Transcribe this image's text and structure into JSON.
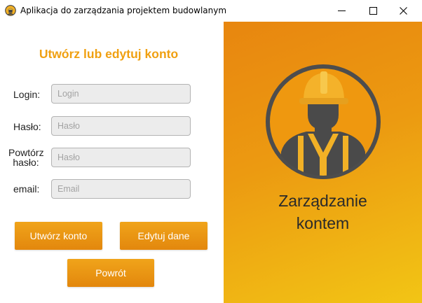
{
  "window": {
    "title": "Aplikacja do zarządzania projektem budowlanym",
    "icon": "worker-helmet-icon",
    "controls": [
      "minimize-icon",
      "maximize-icon",
      "close-icon"
    ]
  },
  "form": {
    "title": "Utwórz lub edytuj konto",
    "fields": [
      {
        "label": "Login:",
        "placeholder": "Login",
        "value": ""
      },
      {
        "label": "Hasło:",
        "placeholder": "Hasło",
        "value": ""
      },
      {
        "label_line1": "Powtórz",
        "label_line2": "hasło:",
        "placeholder": "Hasło",
        "value": ""
      },
      {
        "label": "email:",
        "placeholder": "Email",
        "value": ""
      }
    ],
    "buttons": {
      "create": "Utwórz konto",
      "edit": "Edytuj dane",
      "back": "Powrót"
    }
  },
  "side": {
    "heading_line1": "Zarządzanie",
    "heading_line2": "kontem",
    "image": "construction-worker-icon"
  },
  "colors": {
    "accent": "#f0a011",
    "button_top": "#f0a41a",
    "button_bottom": "#e3870d",
    "panel_gradient_start": "#e8860f",
    "panel_gradient_end": "#f2c515",
    "helmet": "#f4b22a",
    "worker_dark": "#4a4a4a"
  }
}
